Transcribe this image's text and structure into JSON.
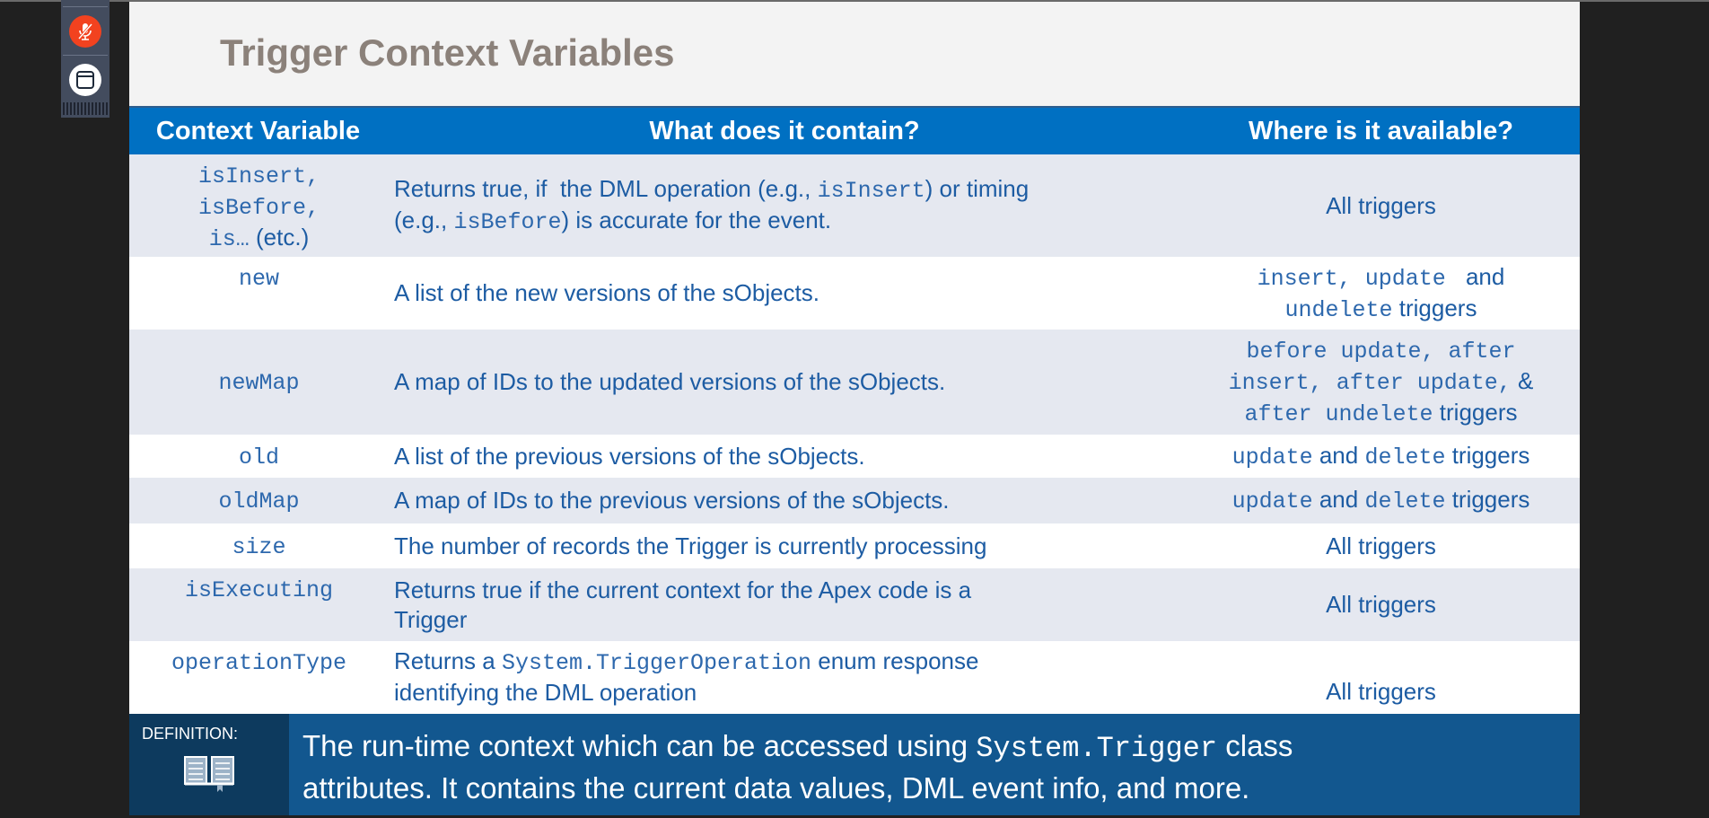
{
  "toolbar": {
    "mic_icon": "microphone-muted-icon",
    "window_icon": "window-icon",
    "mic_color": "#f2421f"
  },
  "slide": {
    "title": "Trigger Context Variables",
    "headers": [
      "Context Variable",
      "What does it contain?",
      "Where is it available?"
    ],
    "rows": [
      {
        "var": [
          [
            {
              "t": "isInsert,",
              "c": true
            }
          ],
          [
            {
              "t": "isBefore,",
              "c": true
            }
          ],
          [
            {
              "t": "is…",
              "c": true
            },
            {
              "t": " (etc.)",
              "c": false
            }
          ]
        ],
        "desc": [
          [
            {
              "t": "Returns true, if  the DML operation (e.g., ",
              "c": false
            },
            {
              "t": "isInsert",
              "c": true
            },
            {
              "t": ") or timing",
              "c": false
            }
          ],
          [
            {
              "t": "(e.g., ",
              "c": false
            },
            {
              "t": "isBefore",
              "c": true
            },
            {
              "t": ") is accurate for the event.",
              "c": false
            }
          ]
        ],
        "avail": [
          [
            {
              "t": "All triggers",
              "c": false
            }
          ]
        ]
      },
      {
        "var": [
          [
            {
              "t": "new",
              "c": true
            }
          ]
        ],
        "desc": [
          [
            {
              "t": "A list of the new versions of the sObjects.",
              "c": false
            }
          ]
        ],
        "avail": [
          [
            {
              "t": "insert, update ",
              "c": true
            },
            {
              "t": " and",
              "c": false
            }
          ],
          [
            {
              "t": "undelete",
              "c": true
            },
            {
              "t": " triggers",
              "c": false
            }
          ]
        ]
      },
      {
        "var": [
          [
            {
              "t": "newMap",
              "c": true
            }
          ]
        ],
        "desc": [
          [
            {
              "t": "A map of IDs to the updated versions of the sObjects.",
              "c": false
            }
          ]
        ],
        "avail": [
          [
            {
              "t": "before update, after",
              "c": true
            }
          ],
          [
            {
              "t": "insert, after update,",
              "c": true
            },
            {
              "t": " &",
              "c": false
            }
          ],
          [
            {
              "t": "after undelete",
              "c": true
            },
            {
              "t": " triggers",
              "c": false
            }
          ]
        ]
      },
      {
        "var": [
          [
            {
              "t": "old",
              "c": true
            }
          ]
        ],
        "desc": [
          [
            {
              "t": "A list of the previous versions of the sObjects.",
              "c": false
            }
          ]
        ],
        "avail": [
          [
            {
              "t": "update",
              "c": true
            },
            {
              "t": " and ",
              "c": false
            },
            {
              "t": "delete",
              "c": true
            },
            {
              "t": " triggers",
              "c": false
            }
          ]
        ]
      },
      {
        "var": [
          [
            {
              "t": "oldMap",
              "c": true
            }
          ]
        ],
        "desc": [
          [
            {
              "t": "A map of IDs to the previous versions of the sObjects.",
              "c": false
            }
          ]
        ],
        "avail": [
          [
            {
              "t": "update",
              "c": true
            },
            {
              "t": " and ",
              "c": false
            },
            {
              "t": "delete",
              "c": true
            },
            {
              "t": " triggers",
              "c": false
            }
          ]
        ]
      },
      {
        "var": [
          [
            {
              "t": "size",
              "c": true
            }
          ]
        ],
        "desc": [
          [
            {
              "t": "The number of records the Trigger is currently processing",
              "c": false
            }
          ]
        ],
        "avail": [
          [
            {
              "t": "All triggers",
              "c": false
            }
          ]
        ]
      },
      {
        "var": [
          [
            {
              "t": "isExecuting",
              "c": true
            }
          ]
        ],
        "desc": [
          [
            {
              "t": "Returns true if the current context for the Apex code is a",
              "c": false
            }
          ],
          [
            {
              "t": "Trigger",
              "c": false
            }
          ]
        ],
        "avail": [
          [
            {
              "t": "All triggers",
              "c": false
            }
          ]
        ]
      },
      {
        "var": [
          [
            {
              "t": "operationType",
              "c": true
            }
          ]
        ],
        "desc": [
          [
            {
              "t": "Returns a ",
              "c": false
            },
            {
              "t": "System.TriggerOperation",
              "c": true
            },
            {
              "t": " enum response",
              "c": false
            }
          ],
          [
            {
              "t": "identifying the DML operation",
              "c": false
            }
          ]
        ],
        "avail": [
          [
            {
              "t": "All triggers",
              "c": false
            }
          ]
        ]
      }
    ],
    "definition": {
      "label": "DEFINITION:",
      "icon": "open-book-icon",
      "text1": "The run-time context which can be accessed using ",
      "code": "System.Trigger",
      "text2": " class",
      "text3": "attributes.  It contains the current data values, DML event info, and more."
    }
  }
}
